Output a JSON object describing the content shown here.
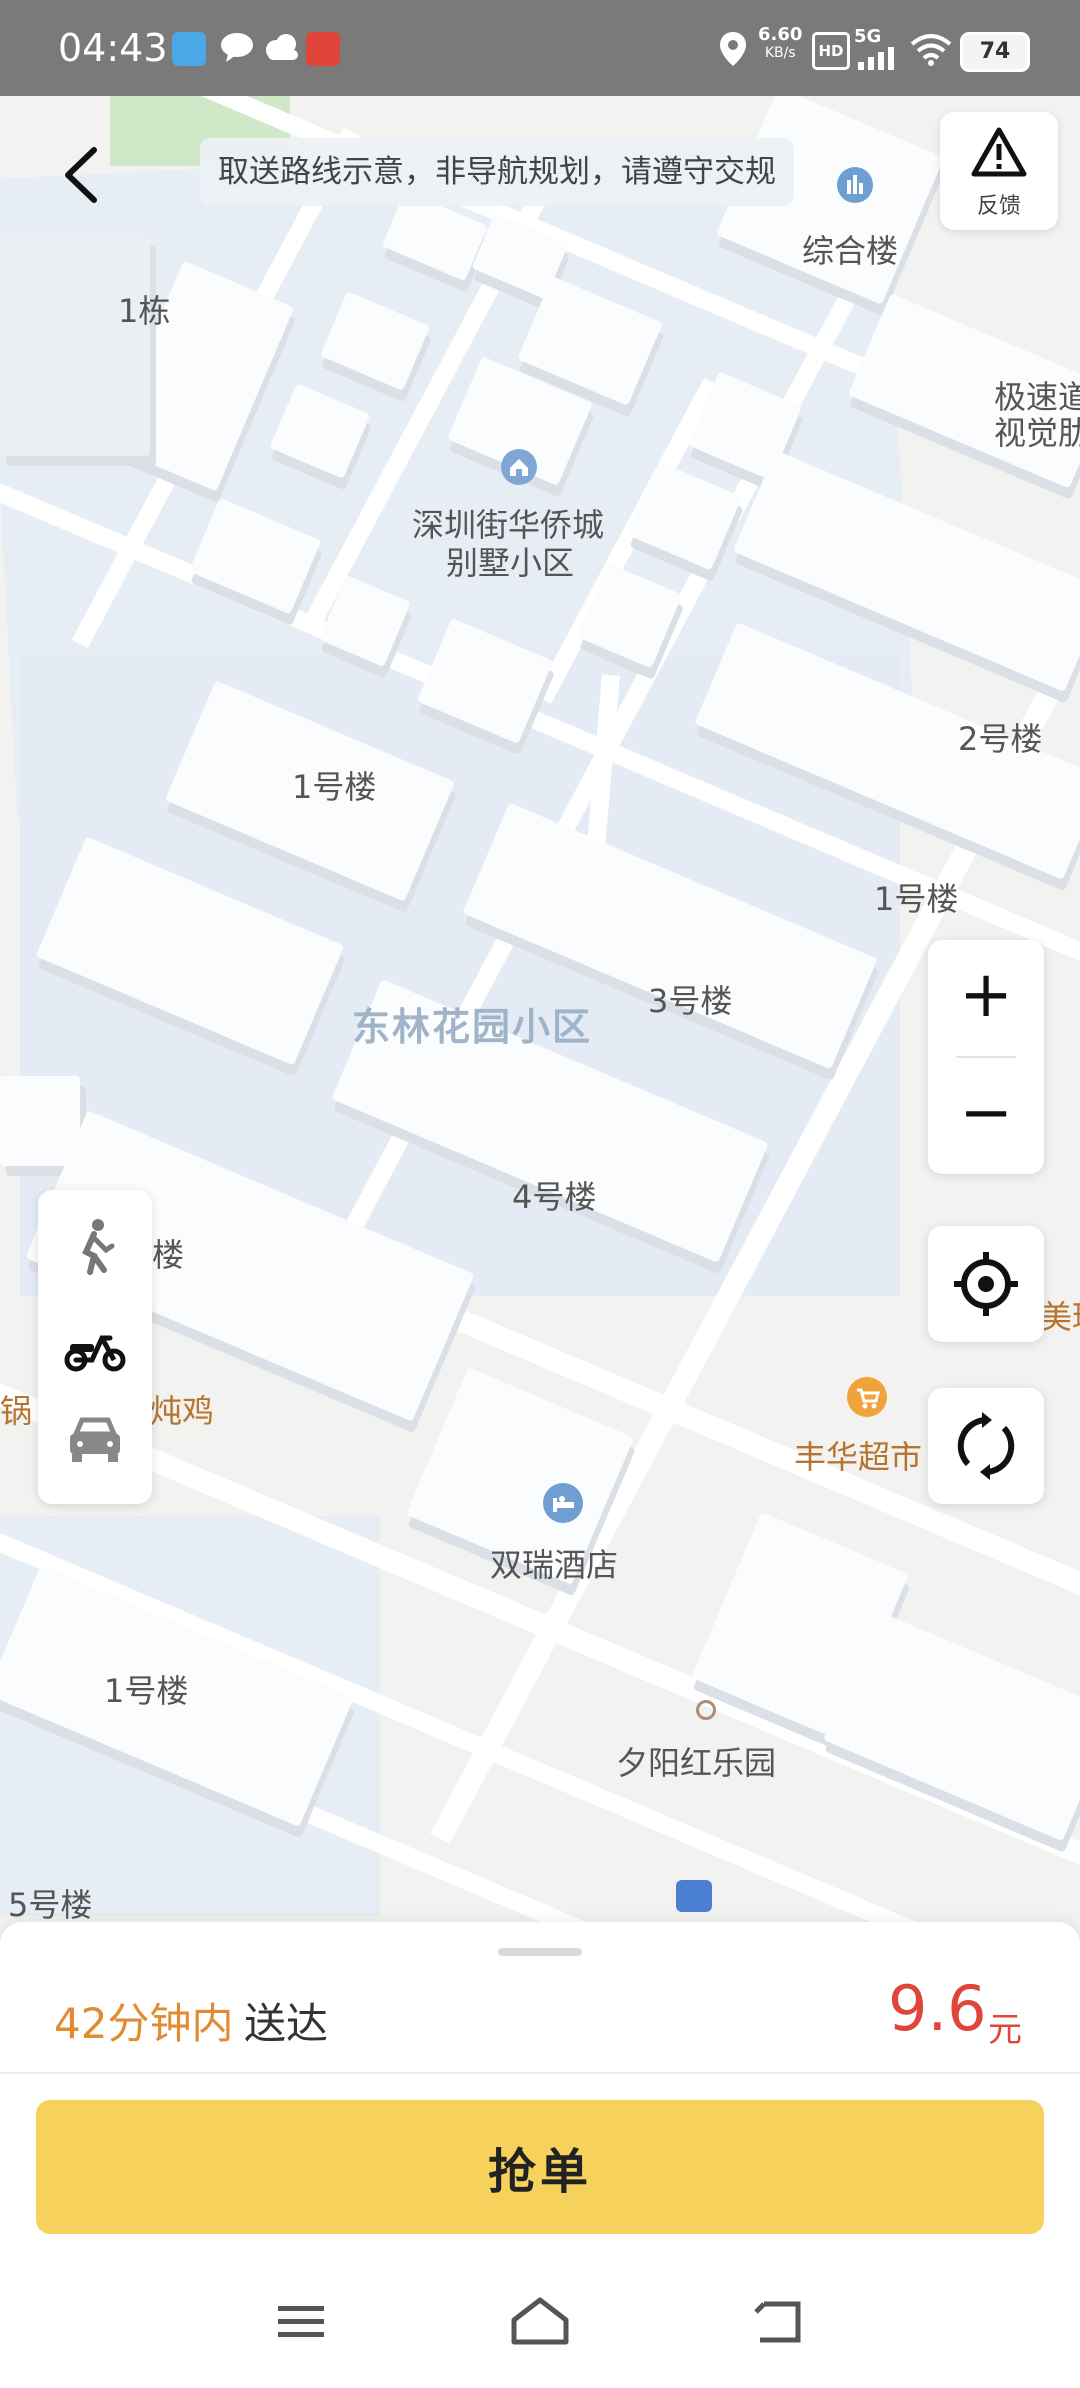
{
  "status_bar": {
    "time": "04:43",
    "net_speed_value": "6.60",
    "net_speed_unit": "KB/s",
    "hd_label": "HD",
    "network": "5G",
    "battery": "74"
  },
  "map": {
    "notice": "取送路线示意，非导航规划，请遵守交规",
    "feedback_label": "反馈",
    "labels": {
      "building_1_dong": "1栋",
      "zonghe_lou": "综合楼",
      "jisu_a": "极速道",
      "jisu_b": "视觉肋",
      "huaqiaocheng_a": "深圳街华侨城",
      "huaqiaocheng_b": "别墅小区",
      "bldg_2": "2号楼",
      "bldg_1_left": "1号楼",
      "bldg_1_right": "1号楼",
      "donglin": "东林花园小区",
      "bldg_3": "3号楼",
      "bldg_4": "4号楼",
      "lou_partial": "楼",
      "guo": "锅",
      "dunji": "炖鸡",
      "shuangrui": "双瑞酒店",
      "fenghua": "丰华超市",
      "partial_right": "美琪",
      "bldg_1_bottom": "1号楼",
      "xiyang": "夕阳红乐园",
      "bldg_5": "5号楼"
    }
  },
  "controls": {
    "zoom_in": "+",
    "zoom_out": "−"
  },
  "order": {
    "eta_time": "42分钟内",
    "eta_suffix": "送达",
    "price": "9.6",
    "price_unit": "元",
    "grab_button": "抢单"
  },
  "colors": {
    "accent_orange": "#e38b33",
    "price_red": "#e0453a",
    "button_yellow": "#f6d15c"
  }
}
